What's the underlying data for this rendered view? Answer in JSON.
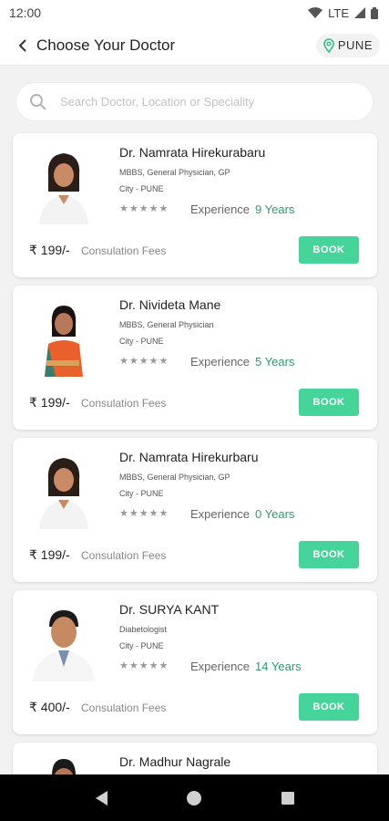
{
  "status_bar": {
    "time": "12:00",
    "network": "LTE"
  },
  "app_bar": {
    "title": "Choose Your Doctor",
    "location": "PUNE"
  },
  "search": {
    "placeholder": "Search Doctor, Location or Speciality"
  },
  "doctors": [
    {
      "name": "Dr. Namrata Hirekurabaru",
      "qualification": "MBBS, General Physician, GP",
      "city": "City - PUNE",
      "stars": "★★★★★",
      "experience_label": "Experience",
      "experience": "9 Years",
      "fee": "₹ 199/-",
      "fee_label": "Consulation Fees",
      "book_label": "BOOK"
    },
    {
      "name": "Dr. Nivideta Mane",
      "qualification": "MBBS, General Physician",
      "city": "City - PUNE",
      "stars": "★★★★★",
      "experience_label": "Experience",
      "experience": "5 Years",
      "fee": "₹ 199/-",
      "fee_label": "Consulation Fees",
      "book_label": "BOOK"
    },
    {
      "name": "Dr. Namrata Hirekurbaru",
      "qualification": "MBBS, General Physician, GP",
      "city": "City - PUNE",
      "stars": "★★★★★",
      "experience_label": "Experience",
      "experience": "0 Years",
      "fee": "₹ 199/-",
      "fee_label": "Consulation Fees",
      "book_label": "BOOK"
    },
    {
      "name": "Dr. SURYA KANT",
      "qualification": "Diabetologist",
      "city": "City - PUNE",
      "stars": "★★★★★",
      "experience_label": "Experience",
      "experience": "14 Years",
      "fee": "₹ 400/-",
      "fee_label": "Consulation Fees",
      "book_label": "BOOK"
    },
    {
      "name": "Dr. Madhur Nagrale"
    }
  ],
  "colors": {
    "accent": "#46d49a",
    "experience": "#2f9a6f",
    "location_pin": "#2fbf86"
  },
  "icons": {
    "back": "back-arrow-icon",
    "location": "location-pin-icon",
    "search": "search-icon"
  }
}
